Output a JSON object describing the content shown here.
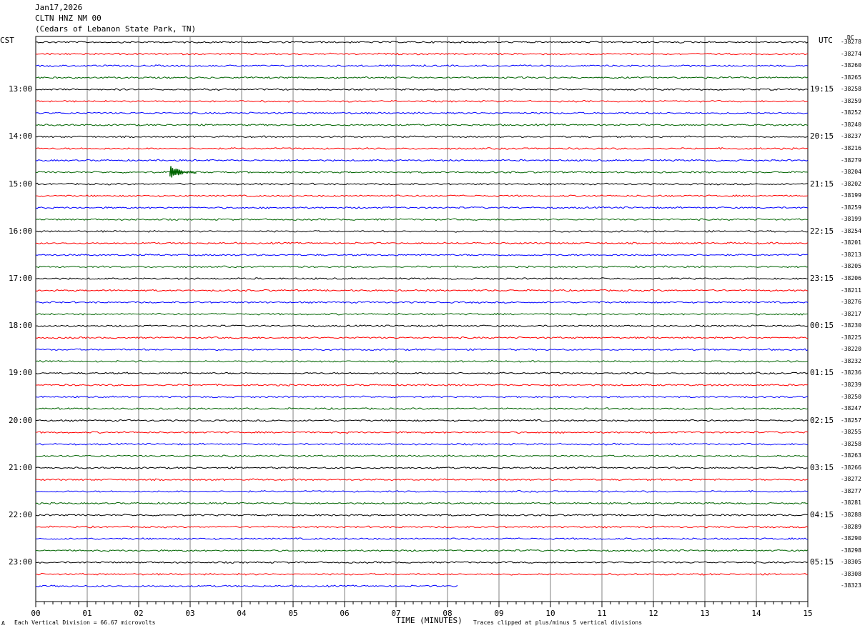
{
  "header": {
    "date": "Jan17,2026",
    "station": "CLTN HNZ NM 00",
    "location": "(Cedars of Lebanon State Park, TN)"
  },
  "left_timezone": "CST",
  "right_timezone": "UTC",
  "dc_label": "DC",
  "left_hour_labels": [
    "13:00",
    "14:00",
    "15:00",
    "16:00",
    "17:00",
    "18:00",
    "19:00",
    "20:00",
    "21:00",
    "22:00",
    "23:00"
  ],
  "right_hour_labels": [
    "19:15",
    "20:15",
    "21:15",
    "22:15",
    "23:15",
    "00:15",
    "01:15",
    "02:15",
    "03:15",
    "04:15",
    "05:15"
  ],
  "footer": {
    "scale_note": "Each Vertical Division =   66.67 microvolts",
    "x_title": "TIME (MINUTES)",
    "clip_note": "Traces clipped at plus/minus 5 vertical divisions",
    "corner_mark": "A"
  },
  "trace_colors": [
    "#000000",
    "#ff0000",
    "#0000ff",
    "#006400"
  ],
  "chart_data": {
    "type": "line",
    "title": "CLTN HNZ NM 00",
    "xlabel": "TIME (MINUTES)",
    "ylabel": "",
    "x_range": [
      0,
      15
    ],
    "x_ticks": [
      "00",
      "01",
      "02",
      "03",
      "04",
      "05",
      "06",
      "07",
      "08",
      "09",
      "10",
      "11",
      "12",
      "13",
      "14",
      "15"
    ],
    "trace_count": 47,
    "trace_minutes": 15,
    "last_trace_end_minute": 8.2,
    "dc_offsets": [
      "-38278",
      "-38274",
      "-38260",
      "-38265",
      "-38258",
      "-38259",
      "-38252",
      "-38240",
      "-38237",
      "-38216",
      "-38279",
      "-38204",
      "-38202",
      "-38199",
      "-38259",
      "-38199",
      "-38254",
      "-38201",
      "-38213",
      "-38205",
      "-38206",
      "-38211",
      "-38276",
      "-38217",
      "-38230",
      "-38225",
      "-38220",
      "-38232",
      "-38236",
      "-38239",
      "-38250",
      "-38247",
      "-38257",
      "-38255",
      "-38258",
      "-38263",
      "-38266",
      "-38272",
      "-38277",
      "-38281",
      "-38288",
      "-38289",
      "-38290",
      "-38298",
      "-38305",
      "-38308",
      "-38323"
    ],
    "events": [
      {
        "trace_index": 11,
        "minute": 2.65,
        "amplitude": 1.2
      }
    ],
    "grid": true
  }
}
